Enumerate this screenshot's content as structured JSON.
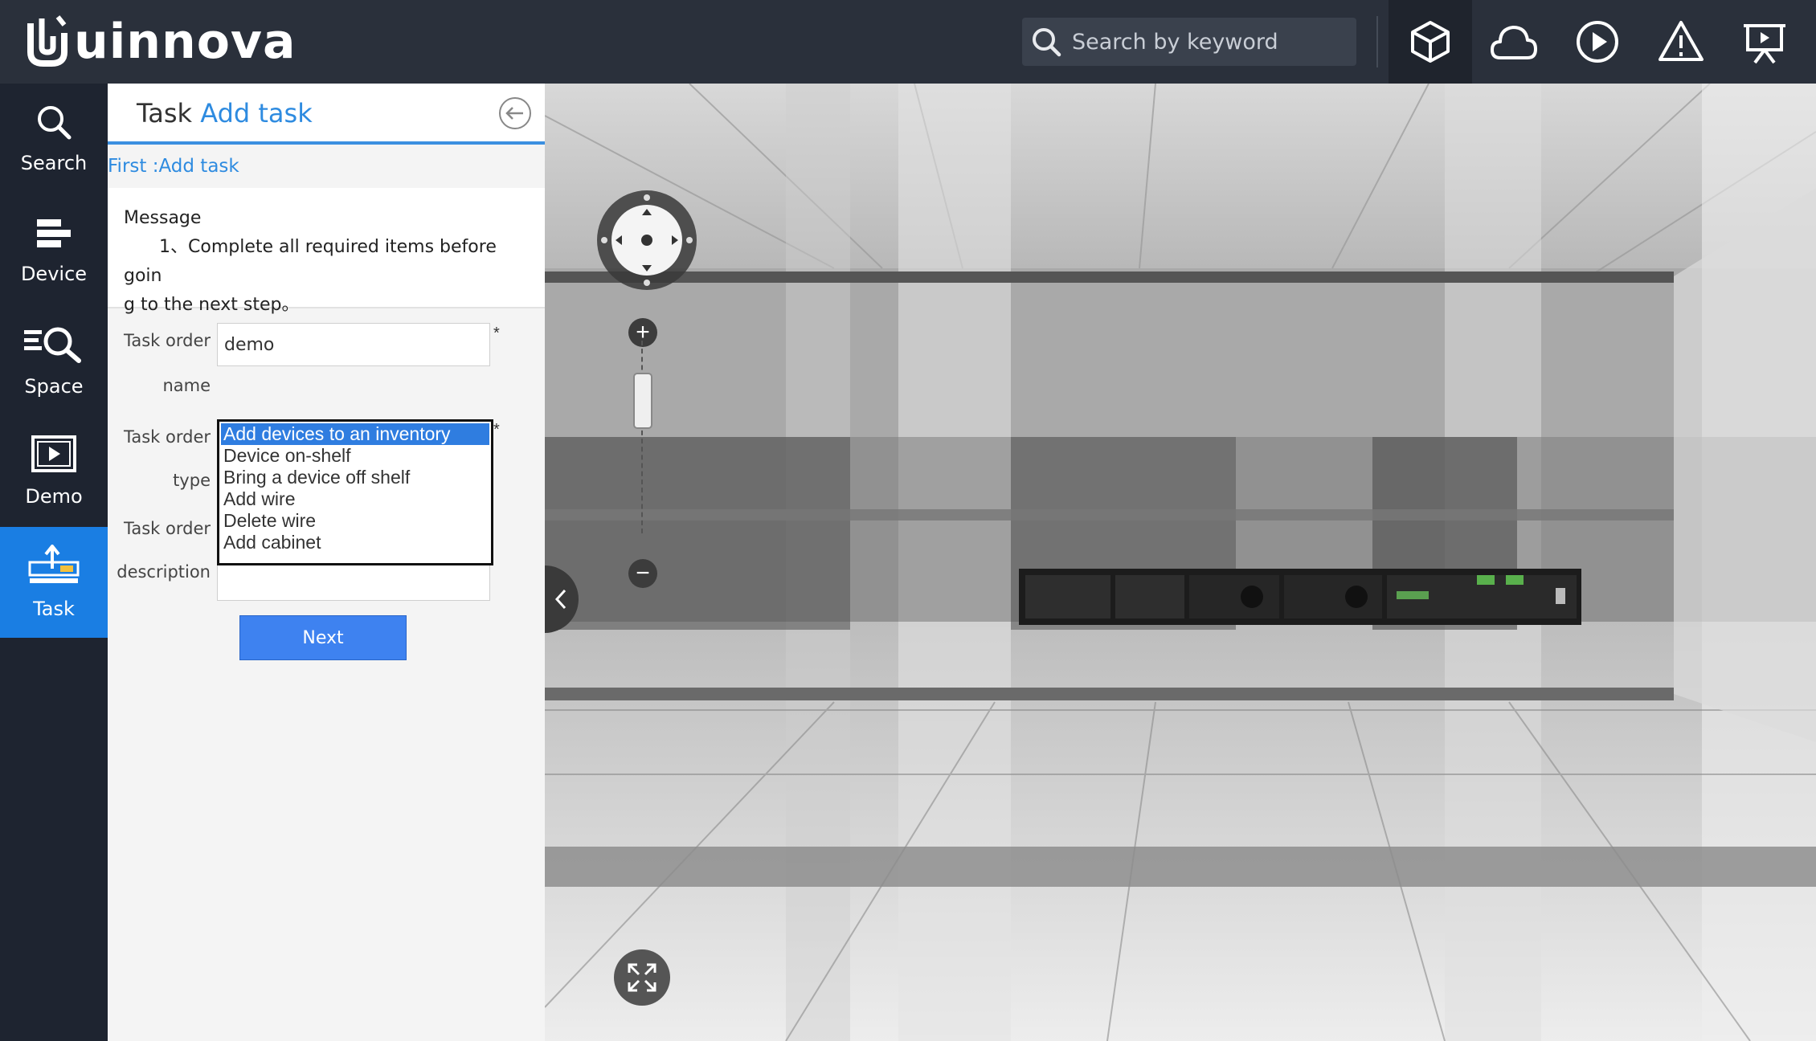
{
  "app": {
    "brand": "uinnova"
  },
  "topbar": {
    "search_placeholder": "Search by keyword",
    "icons": [
      "cube-icon",
      "cloud-icon",
      "play-icon",
      "warning-icon",
      "presentation-icon"
    ]
  },
  "leftnav": {
    "items": [
      {
        "label": "Search",
        "icon": "search-icon"
      },
      {
        "label": "Device",
        "icon": "device-icon"
      },
      {
        "label": "Space",
        "icon": "space-icon"
      },
      {
        "label": "Demo",
        "icon": "demo-icon"
      },
      {
        "label": "Task",
        "icon": "task-icon",
        "active": true
      }
    ]
  },
  "panel": {
    "title_prefix": "Task",
    "title_accent": "Add task",
    "step": "First :Add task",
    "message_title": "Message",
    "message_line1": "1、Complete all required items before goin",
    "message_line2": "g to the next step。",
    "fields": {
      "name_label_1": "Task order",
      "name_label_2": "name",
      "name_value": "demo",
      "type_label_1": "Task order",
      "type_label_2": "type",
      "desc_label_1": "Task order",
      "desc_label_2": "description",
      "required_mark": "*"
    },
    "type_options": [
      "Add devices to an inventory",
      "Device on-shelf",
      "Bring a device off shelf",
      "Add wire",
      "Delete wire",
      "Add cabinet"
    ],
    "selected_type": "Add devices to an inventory",
    "next_label": "Next"
  },
  "viewport": {
    "zoom_plus": "+",
    "zoom_minus": "−"
  },
  "colors": {
    "accent": "#2e8be0",
    "nav_active": "#1a7ee3",
    "topbar": "#2a303b",
    "leftnav": "#1e2430"
  }
}
